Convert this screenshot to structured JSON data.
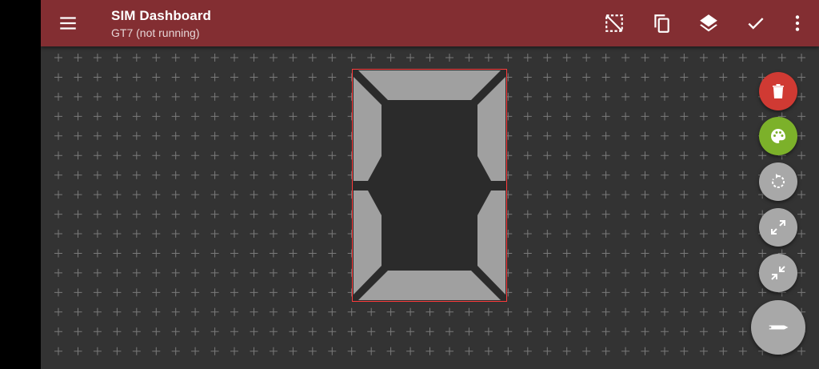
{
  "appbar": {
    "title": "SIM Dashboard",
    "subtitle": "GT7 (not running)",
    "background": "#832e32",
    "icons": {
      "menu": "menu-icon",
      "select": "select-region-icon",
      "copy": "copy-icon",
      "layers": "layers-icon",
      "done": "check-icon",
      "more": "more-vert-icon"
    }
  },
  "canvas": {
    "background": "#333333",
    "grid_mark": "+",
    "widget": {
      "type": "seven-segment-digit",
      "selected": true,
      "segments_on": [
        "top",
        "top-right",
        "top-left",
        "bottom-right",
        "bottom-left",
        "bottom"
      ],
      "segments_off": [
        "middle"
      ],
      "segment_color": "#a0a0a0",
      "selection_border_color": "#ff3b3b"
    }
  },
  "fabs": [
    {
      "name": "delete-button",
      "icon": "trash-icon",
      "color": "#d03a33"
    },
    {
      "name": "palette-button",
      "icon": "palette-icon",
      "color": "#7cb12a"
    },
    {
      "name": "rotate-button",
      "icon": "rotate-icon",
      "color": "#a8a8a8"
    },
    {
      "name": "expand-button",
      "icon": "expand-icon",
      "color": "#a8a8a8"
    },
    {
      "name": "shrink-button",
      "icon": "shrink-icon",
      "color": "#a8a8a8"
    },
    {
      "name": "edit-button",
      "icon": "pen-icon",
      "color": "#a8a8a8"
    }
  ]
}
